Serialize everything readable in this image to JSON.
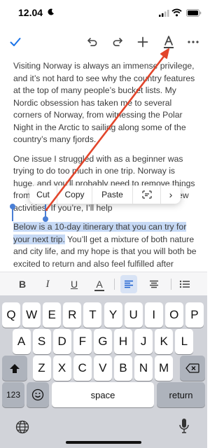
{
  "status_bar": {
    "time": "12.04",
    "icons": [
      "moon-icon",
      "signal-icon",
      "wifi-icon",
      "battery-icon"
    ]
  },
  "toolbar": {
    "buttons": [
      "checkmark-icon",
      "undo-icon",
      "redo-icon",
      "plus-icon",
      "text-format-icon",
      "more-icon"
    ],
    "accent_color": "#1a73e8"
  },
  "document": {
    "paragraph1": "Visiting Norway is always an immense privilege, and it’s not hard to see why the country features at the top of many people’s bucket lists. My Nordic obsession has taken me to several corners of Norway, from witnessing the Polar Night in the Arctic to sailing along some of the country’s many fjords.",
    "paragraph2": "One issue I struggled with as a beginner was trying to do too much in one trip. Norway is huge, and you’ll probably need to remove things from your itinerary rather than struggle for new activities. If you’re",
    "paragraph2_tail": "help",
    "paragraph2_hidden_end": ", I’ll",
    "paragraph3_selected": "Below is a 10-day itinerary that you can try for your next trip.",
    "paragraph3_rest": " You’ll get a mixture of both nature and city life, and my hope is that you will both be excited to return and also feel fulfilled after making lifelong memories.",
    "selection_color": "#c6d9f5"
  },
  "context_menu": {
    "items": [
      "Cut",
      "Copy",
      "Paste"
    ],
    "scan_icon": "scan-text-icon",
    "more_icon": "chevron-right-icon",
    "more_label": "›"
  },
  "annotation": {
    "color": "#e2452b",
    "description_target": "text-format-icon"
  },
  "format_bar": {
    "bold": "B",
    "italic": "I",
    "underline": "U",
    "text_color": "A",
    "icons": [
      "align-left-icon",
      "align-center-icon",
      "bullet-list-icon"
    ]
  },
  "keyboard": {
    "row1": [
      "Q",
      "W",
      "E",
      "R",
      "T",
      "Y",
      "U",
      "I",
      "O",
      "P"
    ],
    "row2": [
      "A",
      "S",
      "D",
      "F",
      "G",
      "H",
      "J",
      "K",
      "L"
    ],
    "row3": [
      "Z",
      "X",
      "C",
      "V",
      "B",
      "N",
      "M"
    ],
    "numbers_key": "123",
    "emoji_icon": "emoji-icon",
    "space": "space",
    "return": "return",
    "shift_icon": "shift-icon",
    "delete_icon": "delete-icon",
    "globe_icon": "globe-icon",
    "mic_icon": "microphone-icon"
  }
}
